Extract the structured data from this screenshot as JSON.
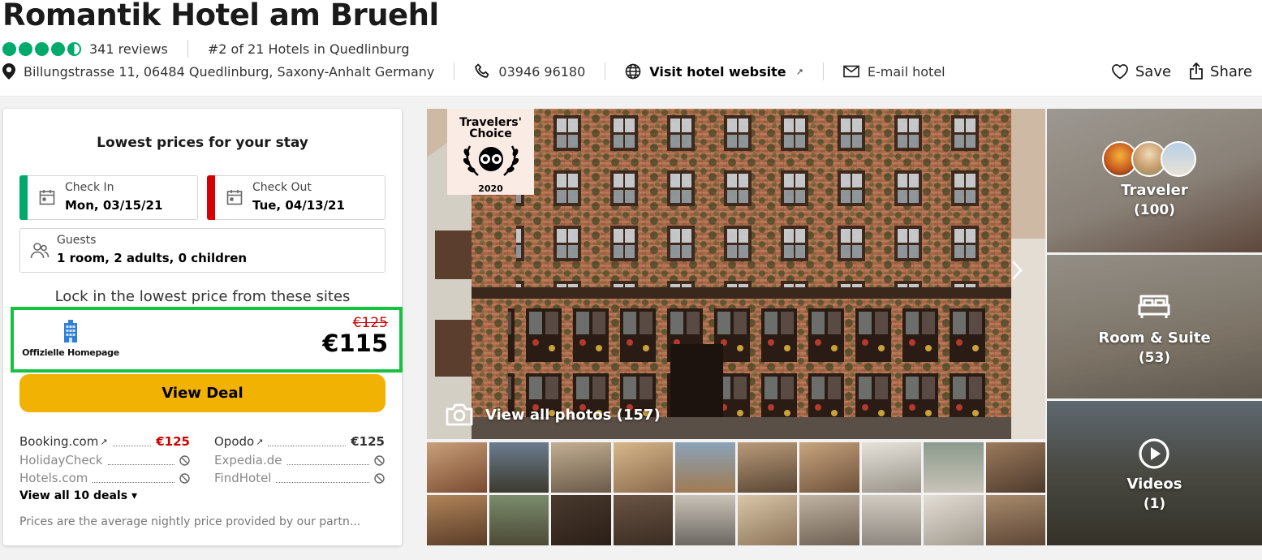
{
  "hotel": {
    "name": "Romantik Hotel am Bruehl",
    "rating_bubbles": 4.5,
    "reviews": "341 reviews",
    "rank": "#2 of 21 Hotels in Quedlinburg",
    "address": "Billungstrasse 11, 06484 Quedlinburg, Saxony-Anhalt Germany",
    "phone": "03946 96180",
    "website": "Visit hotel website",
    "email": "E-mail hotel"
  },
  "actions": {
    "save": "Save",
    "share": "Share"
  },
  "booking": {
    "heading": "Lowest prices for your stay",
    "check_in": {
      "label": "Check In",
      "value": "Mon, 03/15/21",
      "accent": "#00aa6c"
    },
    "check_out": {
      "label": "Check Out",
      "value": "Tue, 04/13/21",
      "accent": "#d50000"
    },
    "guests": {
      "label": "Guests",
      "value": "1 room, 2 adults, 0 children"
    },
    "lock_in": "Lock in the lowest price from these sites",
    "featured": {
      "provider": "Offizielle Homepage",
      "old_price": "€125",
      "price": "€115",
      "highlight_color": "#19c142"
    },
    "view_deal": "View Deal",
    "deals": [
      {
        "name": "Booking.com",
        "external": true,
        "price": "€125",
        "price_color": "red"
      },
      {
        "name": "Opodo",
        "external": true,
        "price": "€125",
        "price_color": "black"
      },
      {
        "name": "HolidayCheck",
        "external": false,
        "price": null
      },
      {
        "name": "Expedia.de",
        "external": false,
        "price": null
      },
      {
        "name": "Hotels.com",
        "external": false,
        "price": null
      },
      {
        "name": "FindHotel",
        "external": false,
        "price": null
      }
    ],
    "view_all": "View all 10 deals",
    "disclaimer": "Prices are the average nightly price provided by our partn..."
  },
  "gallery": {
    "badge": {
      "line1": "Travelers'",
      "line2": "Choice",
      "year": "2020"
    },
    "view_all_photos": "View all photos (157)",
    "tiles": [
      {
        "label": "Traveler",
        "count": "(100)",
        "icon": "avatars"
      },
      {
        "label": "Room & Suite",
        "count": "(53)",
        "icon": "bed-icon"
      },
      {
        "label": "Videos",
        "count": "(1)",
        "icon": "play-icon"
      }
    ],
    "thumbnail_count": 20
  },
  "colors": {
    "brand_green": "#00aa6c",
    "cta_yellow": "#f2b203",
    "price_red": "#cc0000",
    "highlight_green": "#19c142"
  }
}
